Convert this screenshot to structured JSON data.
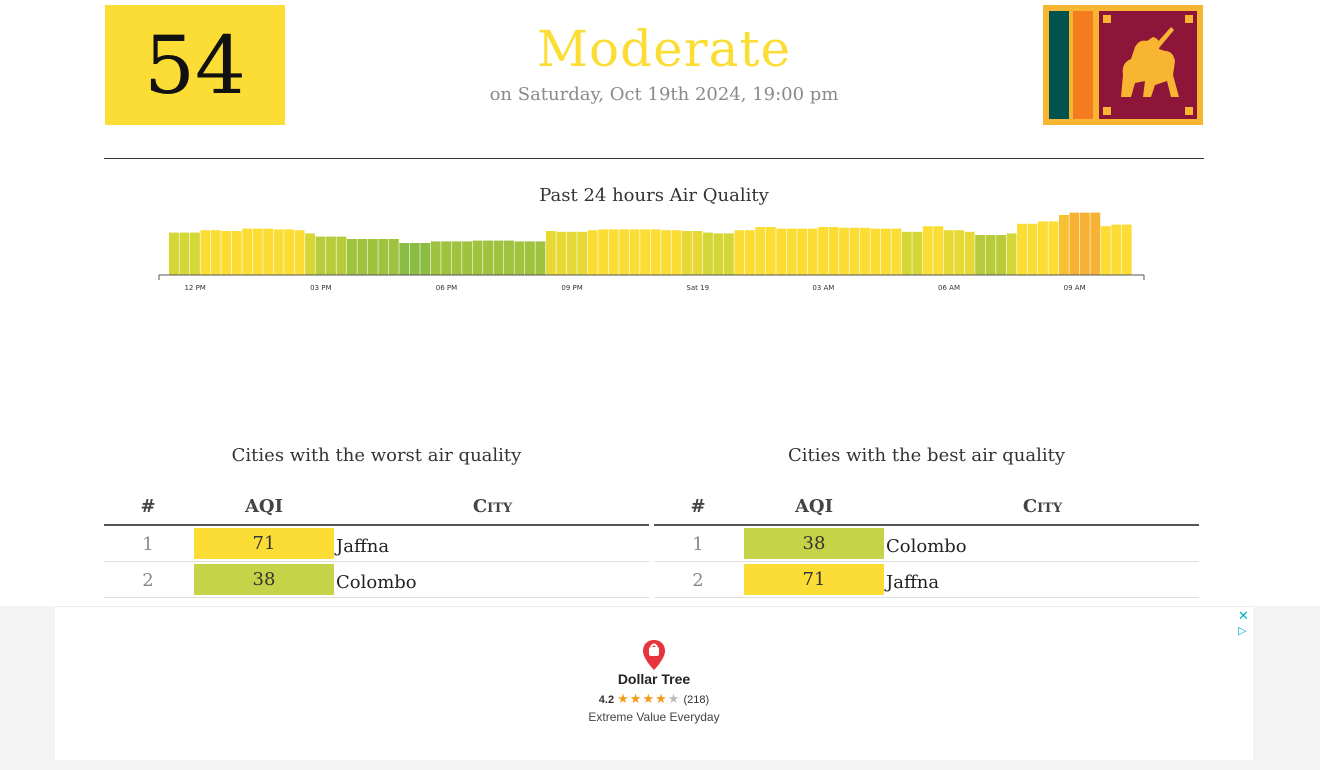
{
  "current": {
    "aqi": "54",
    "status": "Moderate",
    "date": "on Saturday, Oct 19th 2024, 19:00 pm",
    "color": "#fcdd35"
  },
  "chart_data": {
    "type": "bar",
    "title": "Past 24 hours Air Quality",
    "x_tick_labels": [
      "12 PM",
      "03 PM",
      "06 PM",
      "09 PM",
      "Sat 19",
      "03 AM",
      "06 AM",
      "09 AM"
    ],
    "values": [
      53,
      53,
      53,
      56,
      56,
      55,
      55,
      58,
      58,
      58,
      57,
      57,
      56,
      52,
      48,
      48,
      48,
      45,
      45,
      45,
      45,
      45,
      40,
      40,
      40,
      42,
      42,
      42,
      42,
      43,
      43,
      43,
      43,
      42,
      42,
      42,
      55,
      54,
      54,
      54,
      56,
      57,
      57,
      57,
      57,
      57,
      57,
      56,
      56,
      55,
      55,
      53,
      52,
      52,
      56,
      56,
      60,
      60,
      58,
      58,
      58,
      58,
      60,
      60,
      59,
      59,
      59,
      58,
      58,
      58,
      54,
      54,
      61,
      61,
      56,
      56,
      54,
      50,
      50,
      50,
      52,
      64,
      64,
      67,
      67,
      75,
      78,
      78,
      78,
      61,
      63,
      63
    ],
    "colors": [
      "#d4d735",
      "#d4d735",
      "#d4d735",
      "#fcdd35",
      "#fcdd35",
      "#fcdd35",
      "#fcdd35",
      "#fcdd35",
      "#fcdd35",
      "#fcdd35",
      "#fcdd35",
      "#fcdd35",
      "#fcdd35",
      "#d4d735",
      "#b8cb3a",
      "#b8cb3a",
      "#b8cb3a",
      "#9fc23f",
      "#9fc23f",
      "#9fc23f",
      "#9fc23f",
      "#9fc23f",
      "#8bbc44",
      "#8bbc44",
      "#8bbc44",
      "#9fc23f",
      "#9fc23f",
      "#9fc23f",
      "#9fc23f",
      "#9fc23f",
      "#9fc23f",
      "#9fc23f",
      "#9fc23f",
      "#9fc23f",
      "#9fc23f",
      "#9fc23f",
      "#e6d935",
      "#e6d935",
      "#e6d935",
      "#e6d935",
      "#fcdd35",
      "#fcdd35",
      "#fcdd35",
      "#fcdd35",
      "#fcdd35",
      "#fcdd35",
      "#fcdd35",
      "#fcdd35",
      "#fcdd35",
      "#e6d935",
      "#e6d935",
      "#d4d735",
      "#d4d735",
      "#d4d735",
      "#fcdd35",
      "#fcdd35",
      "#fcdd35",
      "#fcdd35",
      "#fcdd35",
      "#fcdd35",
      "#fcdd35",
      "#fcdd35",
      "#fcdd35",
      "#fcdd35",
      "#fcdd35",
      "#fcdd35",
      "#fcdd35",
      "#fcdd35",
      "#fcdd35",
      "#fcdd35",
      "#d4d735",
      "#d4d735",
      "#fcdd35",
      "#fcdd35",
      "#e6d935",
      "#e6d935",
      "#e6d935",
      "#b8cb3a",
      "#b8cb3a",
      "#b8cb3a",
      "#d4d735",
      "#fcdd35",
      "#fcdd35",
      "#fcdd35",
      "#fcdd35",
      "#f7c033",
      "#f7b233",
      "#f7b233",
      "#f7b233",
      "#fcdd35",
      "#fcdd35",
      "#fcdd35"
    ],
    "ylim": [
      0,
      100
    ]
  },
  "worst": {
    "title": "Cities with the worst air quality",
    "headers": {
      "rank": "#",
      "aqi": "AQI",
      "city": "City"
    },
    "rows": [
      {
        "rank": "1",
        "aqi": "71",
        "city": "Jaffna",
        "color": "#fcdd35"
      },
      {
        "rank": "2",
        "aqi": "38",
        "city": "Colombo",
        "color": "#c5d348"
      }
    ]
  },
  "best": {
    "title": "Cities with the best air quality",
    "headers": {
      "rank": "#",
      "aqi": "AQI",
      "city": "City"
    },
    "rows": [
      {
        "rank": "1",
        "aqi": "38",
        "city": "Colombo",
        "color": "#c5d348"
      },
      {
        "rank": "2",
        "aqi": "71",
        "city": "Jaffna",
        "color": "#fcdd35"
      }
    ]
  },
  "ad": {
    "name": "Dollar Tree",
    "rating": "4.2",
    "reviews": "(218)",
    "tagline": "Extreme Value Everyday",
    "close_icon": "close-icon",
    "adchoices_icon": "adchoices-icon",
    "star_color": "#f39b12"
  }
}
